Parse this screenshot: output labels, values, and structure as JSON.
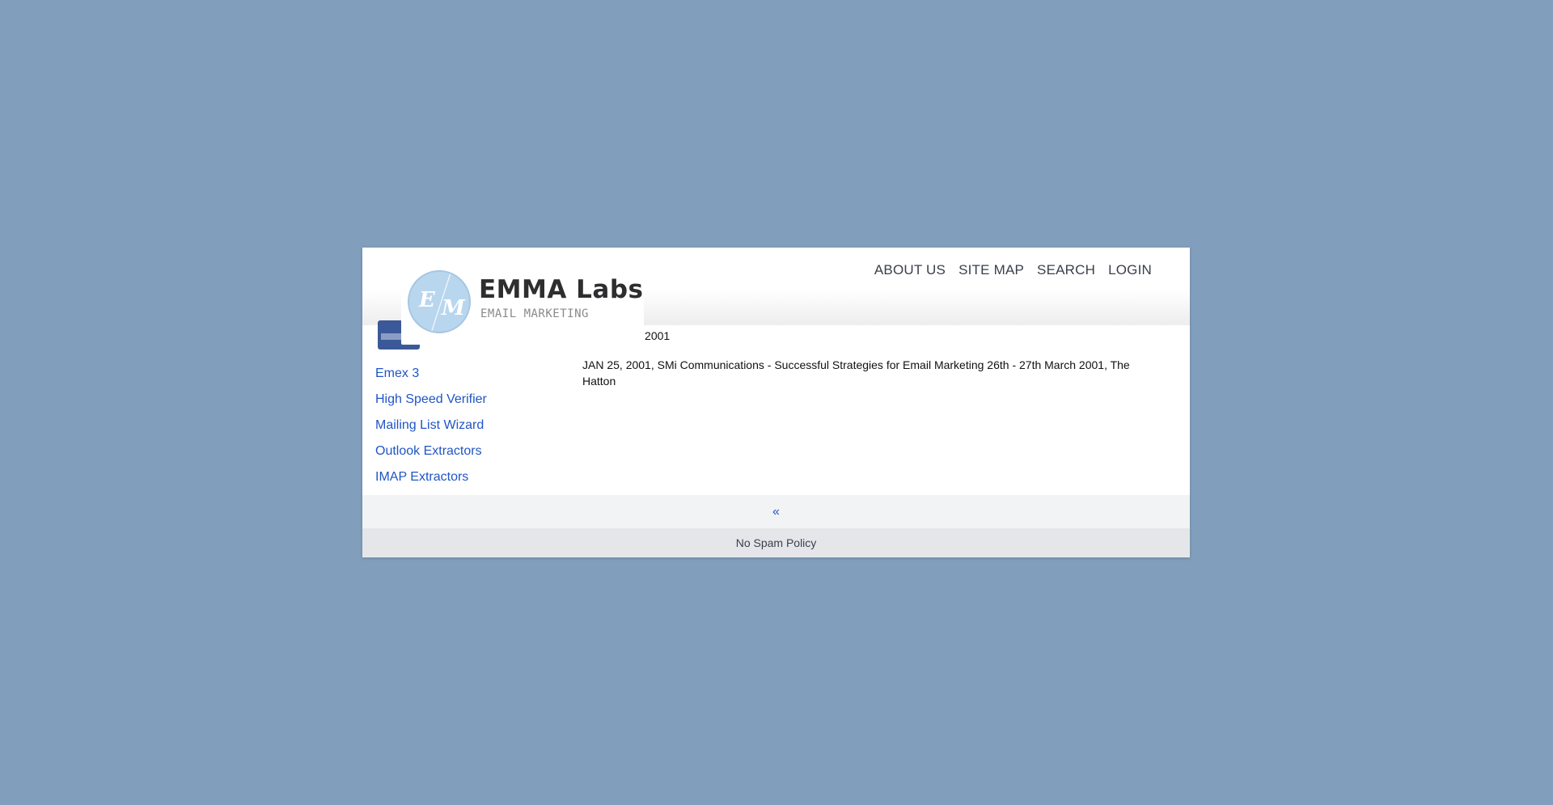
{
  "header": {
    "nav": [
      "ABOUT US",
      "SITE MAP",
      "SEARCH",
      "LOGIN"
    ]
  },
  "logo": {
    "initial_1": "E",
    "initial_2": "M",
    "name": "EMMA Labs",
    "tagline": "EMAIL MARKETING"
  },
  "social": {
    "badge_text": "facebook",
    "icon": "facebook-icon"
  },
  "sidebar": {
    "items": [
      "Emex 3",
      "High Speed Verifier",
      "Mailing List Wizard",
      "Outlook Extractors",
      "IMAP Extractors"
    ]
  },
  "content": {
    "date": "January 25, 2001",
    "article": "JAN 25, 2001, SMi Communications - Successful Strategies for Email Marketing 26th - 27th March 2001, The Hatton"
  },
  "pager": {
    "prev_label": "«"
  },
  "footer": {
    "link": "No Spam Policy"
  },
  "colors": {
    "background": "#819fbd",
    "link": "#2055c6",
    "facebook": "#3b5998",
    "logo_circle": "#b9d6ef"
  }
}
